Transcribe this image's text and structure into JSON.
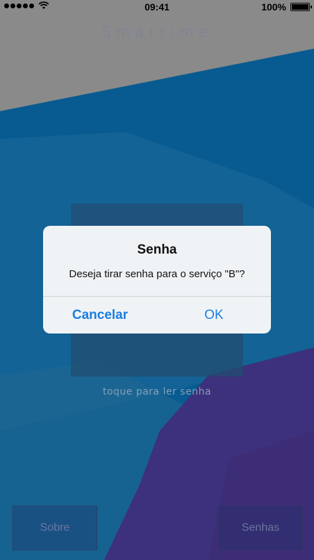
{
  "status_bar": {
    "time": "09:41",
    "battery": "100%"
  },
  "app": {
    "title": "Smartime",
    "hint": "toque para ler senha",
    "buttons": {
      "left": "Sobre",
      "right": "Senhas"
    }
  },
  "alert": {
    "title": "Senha",
    "message": "Deseja tirar senha para o serviço \"B\"?",
    "cancel_label": "Cancelar",
    "ok_label": "OK"
  },
  "colors": {
    "top_band": "#a9a9a9",
    "blue": "#0a73b5",
    "purple": "#4b3b98",
    "alert_button": "#1a7ee0"
  }
}
